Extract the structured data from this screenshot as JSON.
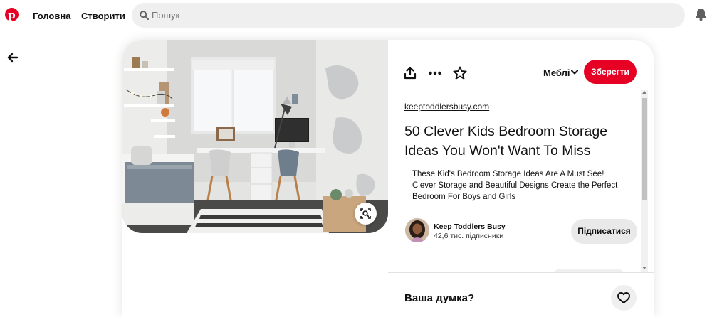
{
  "header": {
    "logo_icon": "pinterest-logo",
    "nav": [
      {
        "label": "Головна"
      },
      {
        "label": "Створити"
      }
    ],
    "search": {
      "placeholder": "Пошук",
      "value": ""
    },
    "notifications_icon": "bell-icon"
  },
  "back_icon": "arrow-left-icon",
  "pin": {
    "image_alt_icon": "visual-search-icon",
    "actions": [
      "share-icon",
      "more-icon",
      "star-icon"
    ],
    "board": "Меблі",
    "save_label": "Зберегти",
    "domain": "keeptoddlersbusy.com",
    "title": "50 Clever Kids Bedroom Storage Ideas You Won't Want To Miss",
    "description": "These Kid's Bedroom Storage Ideas Are A Must See! Clever Storage and Beautiful Designs Create the Perfect Bedroom For Boys and Girls",
    "creator": {
      "name": "Keep Toddlers Busy",
      "followers": "42,6 тис. підписники",
      "subscribe_label": "Підписатися"
    },
    "comment_prompt": "Ваша думка?"
  },
  "colors": {
    "accent": "#e60023",
    "button_gray": "#e9e9e9",
    "search_bg": "#efefef"
  }
}
